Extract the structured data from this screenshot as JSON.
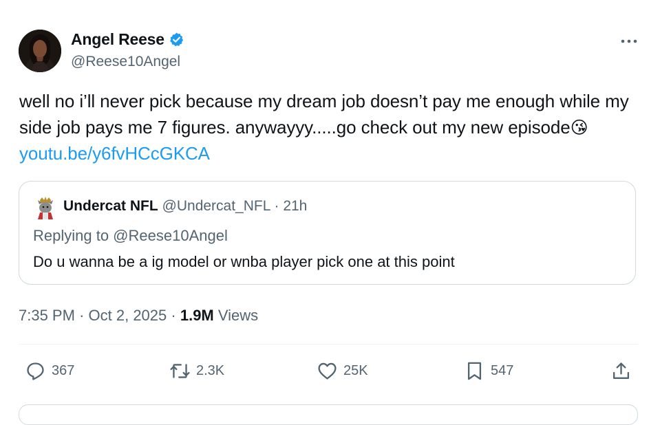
{
  "author": {
    "name": "Angel Reese",
    "handle": "@Reese10Angel",
    "verified_color": "#1d9bf0",
    "avatar_icon": "profile-photo"
  },
  "tweet": {
    "text_main": "well no i’ll never pick because my dream job doesn’t pay me enough while my side job pays me 7 figures. anywayyy.....go check out my new episode",
    "emoji": "😘",
    "link": "youtu.be/y6fvHCcGKCA",
    "link_color": "#1d9bf0"
  },
  "quote": {
    "name": "Undercat NFL",
    "handle": "@Undercat_NFL",
    "separator": "·",
    "time": "21h",
    "replying_to": "Replying to @Reese10Angel",
    "text": "Do u wanna be a ig model or wnba player pick one at this point"
  },
  "meta": {
    "time": "7:35 PM",
    "separator": "·",
    "date": "Oct 2, 2025",
    "views_count": "1.9M",
    "views_label": "Views"
  },
  "actions": {
    "reply": {
      "icon": "reply-icon",
      "count": "367"
    },
    "retweet": {
      "icon": "retweet-icon",
      "count": "2.3K"
    },
    "like": {
      "icon": "heart-icon",
      "count": "25K"
    },
    "bookmark": {
      "icon": "bookmark-icon",
      "count": "547"
    },
    "share": {
      "icon": "share-icon"
    }
  }
}
